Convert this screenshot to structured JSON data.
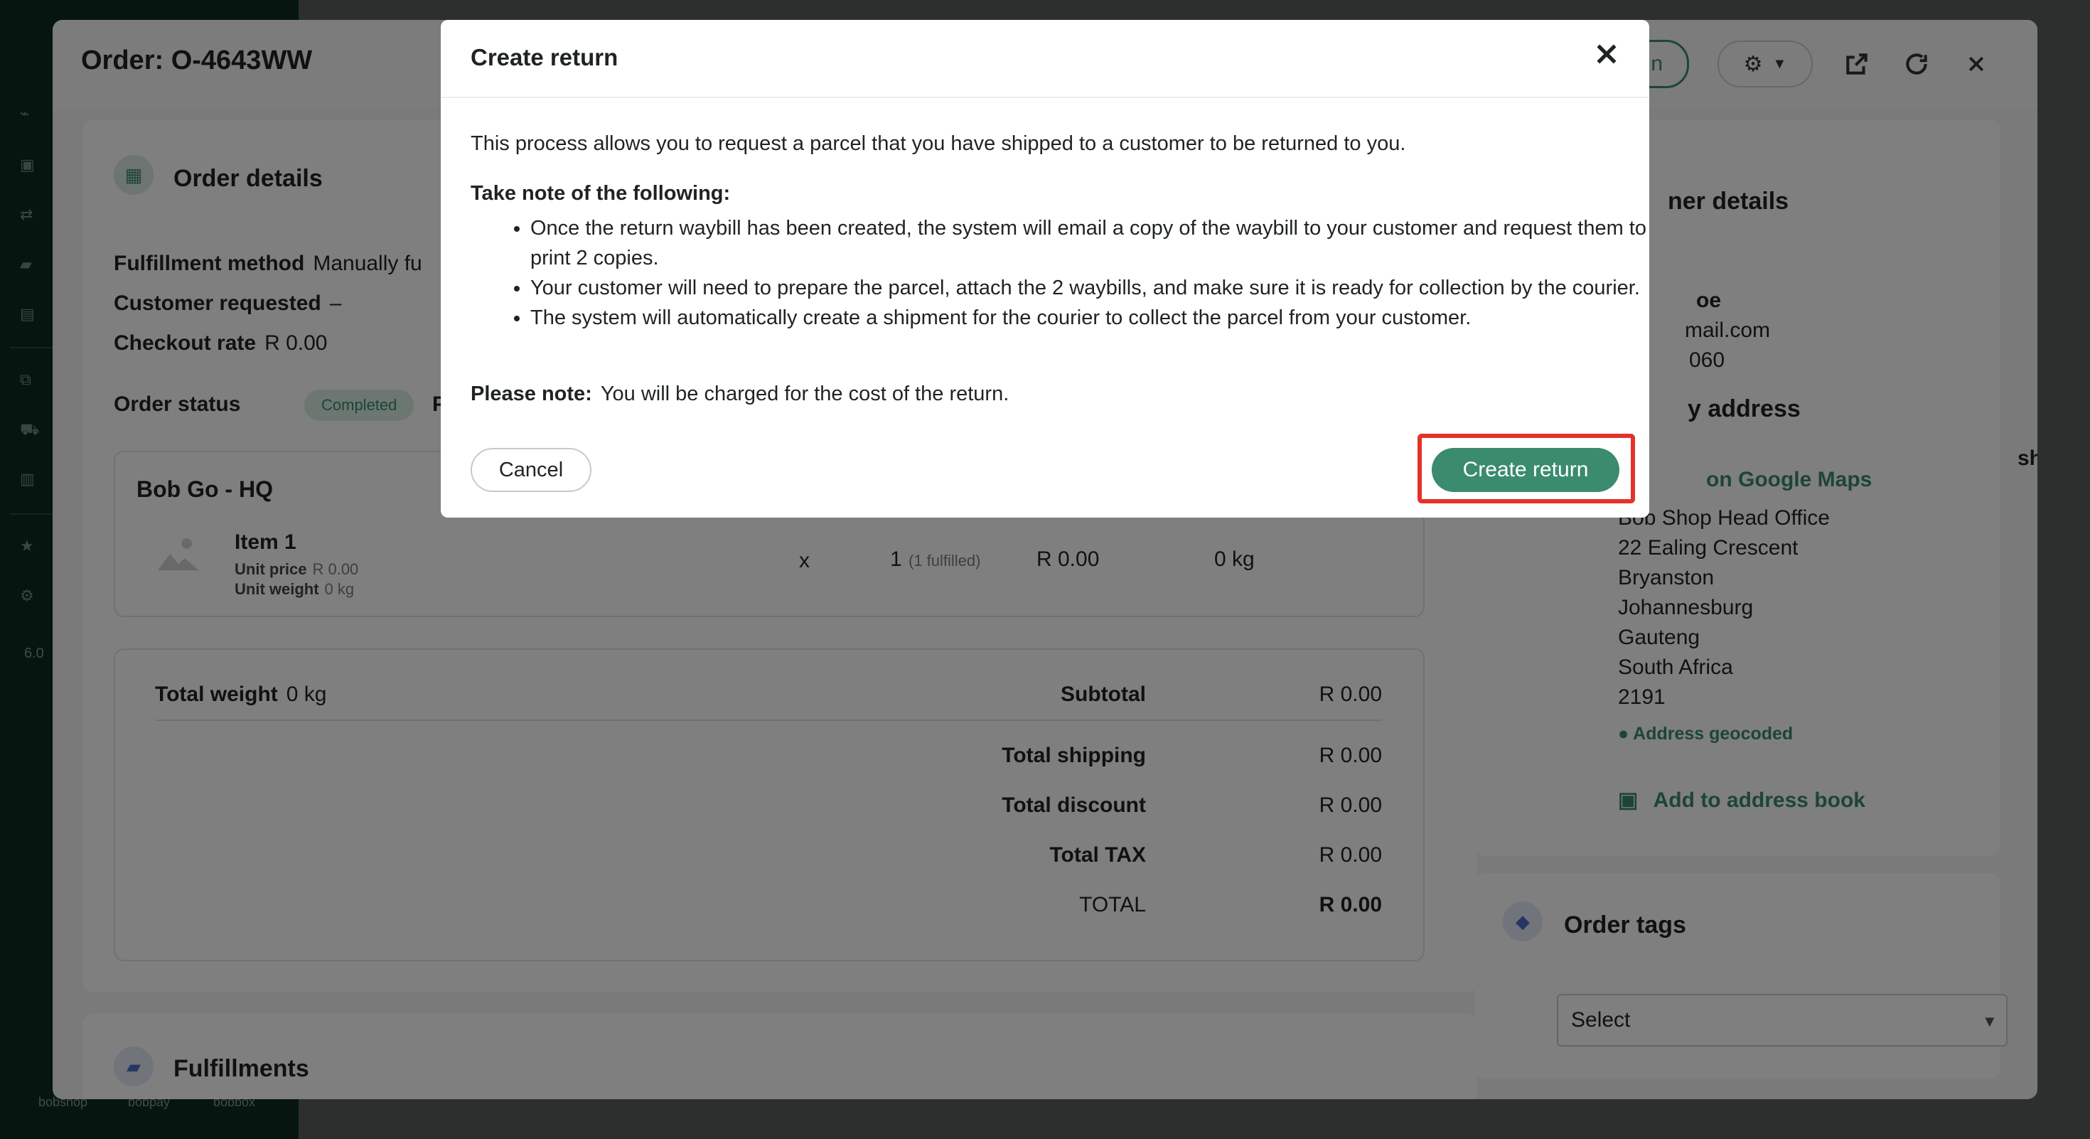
{
  "sidebar": {
    "version": "6.0",
    "icons": [
      "chart-icon",
      "box-icon",
      "transfer-icon",
      "truck-icon",
      "document-icon",
      "hierarchy-icon",
      "cart-icon",
      "file-icon",
      "star-icon",
      "gear-icon"
    ],
    "brands": [
      "bobshop",
      "bobpay",
      "bobbox"
    ]
  },
  "panel": {
    "title": "Order: O-4643WW",
    "return_button_partial": "n",
    "actions": [
      "settings-icon",
      "open-external-icon",
      "refresh-icon",
      "close-icon"
    ]
  },
  "order_details": {
    "title": "Order details",
    "fulfillment_method_label": "Fulfillment method",
    "fulfillment_method_value": "Manually fu",
    "customer_requested_label": "Customer requested",
    "customer_requested_value": "–",
    "checkout_rate_label": "Checkout rate",
    "checkout_rate_value": "R 0.00",
    "order_status_label": "Order status",
    "order_status_value": "Completed",
    "payment_label_partial": "Pay"
  },
  "location": {
    "name": "Bob Go - HQ",
    "item_name": "Item 1",
    "unit_price_label": "Unit price",
    "unit_price_value": "R 0.00",
    "unit_weight_label": "Unit weight",
    "unit_weight_value": "0 kg",
    "multiplier": "x",
    "qty": "1",
    "qty_note": "(1 fulfilled)",
    "price": "R 0.00",
    "weight": "0 kg"
  },
  "totals": {
    "total_weight_label": "Total weight",
    "total_weight_value": "0 kg",
    "rows": [
      {
        "label": "Subtotal",
        "value": "R 0.00"
      },
      {
        "label": "Total shipping",
        "value": "R 0.00"
      },
      {
        "label": "Total discount",
        "value": "R 0.00"
      },
      {
        "label": "Total TAX",
        "value": "R 0.00"
      },
      {
        "label": "TOTAL",
        "value": "R 0.00"
      }
    ]
  },
  "customer": {
    "title_partial": "ner details",
    "name_partial": "oe",
    "email_partial": "mail.com",
    "phone_partial": "060",
    "address_title_partial": "y address",
    "maps_partial": "on Google Maps",
    "address_lines": [
      "Bob Shop Head Office",
      "22 Ealing Crescent",
      "Bryanston",
      "Johannesburg",
      "Gauteng",
      "South Africa",
      "2191"
    ],
    "geocoded": "Address geocoded",
    "add_to_book": "Add to address book",
    "edge_partial": "sh"
  },
  "tags": {
    "title": "Order tags",
    "select_value": "Select"
  },
  "fulfillments": {
    "title": "Fulfillments"
  },
  "modal": {
    "title": "Create return",
    "intro": "This process allows you to request a parcel that you have shipped to a customer to be returned to you.",
    "note_heading": "Take note of the following:",
    "bullets": [
      "Once the return waybill has been created, the system will email a copy of the waybill to your customer and request them to print 2 copies.",
      "Your customer will need to prepare the parcel, attach the 2 waybills, and make sure it is ready for collection by the courier.",
      "The system will automatically create a shipment for the courier to collect the parcel from your customer."
    ],
    "please_note_label": "Please note:",
    "please_note_text": "You will be charged for the cost of the return.",
    "cancel_label": "Cancel",
    "create_label": "Create return"
  }
}
